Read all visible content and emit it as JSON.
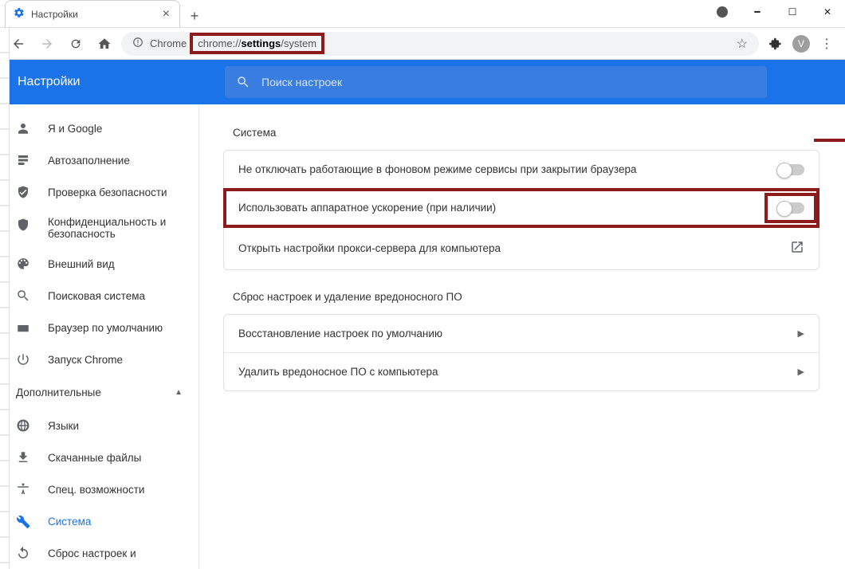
{
  "tab": {
    "title": "Настройки"
  },
  "omnibox": {
    "prefix": "Chrome",
    "url_pre": "chrome://",
    "url_b": "settings",
    "url_post": "/system"
  },
  "avatar_letter": "V",
  "header": {
    "title": "Настройки",
    "search_placeholder": "Поиск настроек"
  },
  "sidebar": {
    "items": [
      {
        "id": "you-google",
        "label": "Я и Google"
      },
      {
        "id": "autofill",
        "label": "Автозаполнение"
      },
      {
        "id": "safety",
        "label": "Проверка безопасности"
      },
      {
        "id": "privacy",
        "label": "Конфиденциальность и безопасность"
      },
      {
        "id": "appearance",
        "label": "Внешний вид"
      },
      {
        "id": "search",
        "label": "Поисковая система"
      },
      {
        "id": "default-browser",
        "label": "Браузер по умолчанию"
      },
      {
        "id": "startup",
        "label": "Запуск Chrome"
      }
    ],
    "advanced_label": "Дополнительные",
    "advanced": [
      {
        "id": "languages",
        "label": "Языки"
      },
      {
        "id": "downloads",
        "label": "Скачанные файлы"
      },
      {
        "id": "accessibility",
        "label": "Спец. возможности"
      },
      {
        "id": "system",
        "label": "Система"
      },
      {
        "id": "reset",
        "label": "Сброс настроек и"
      }
    ]
  },
  "content": {
    "system_section": "Система",
    "rows": {
      "bg": "Не отключать работающие в фоновом режиме сервисы при закрытии браузера",
      "hw": "Использовать аппаратное ускорение (при наличии)",
      "proxy": "Открыть настройки прокси-сервера для компьютера"
    },
    "reset_section": "Сброс настроек и удаление вредоносного ПО",
    "reset_rows": {
      "restore": "Восстановление настроек по умолчанию",
      "cleanup": "Удалить вредоносное ПО с компьютера"
    }
  }
}
